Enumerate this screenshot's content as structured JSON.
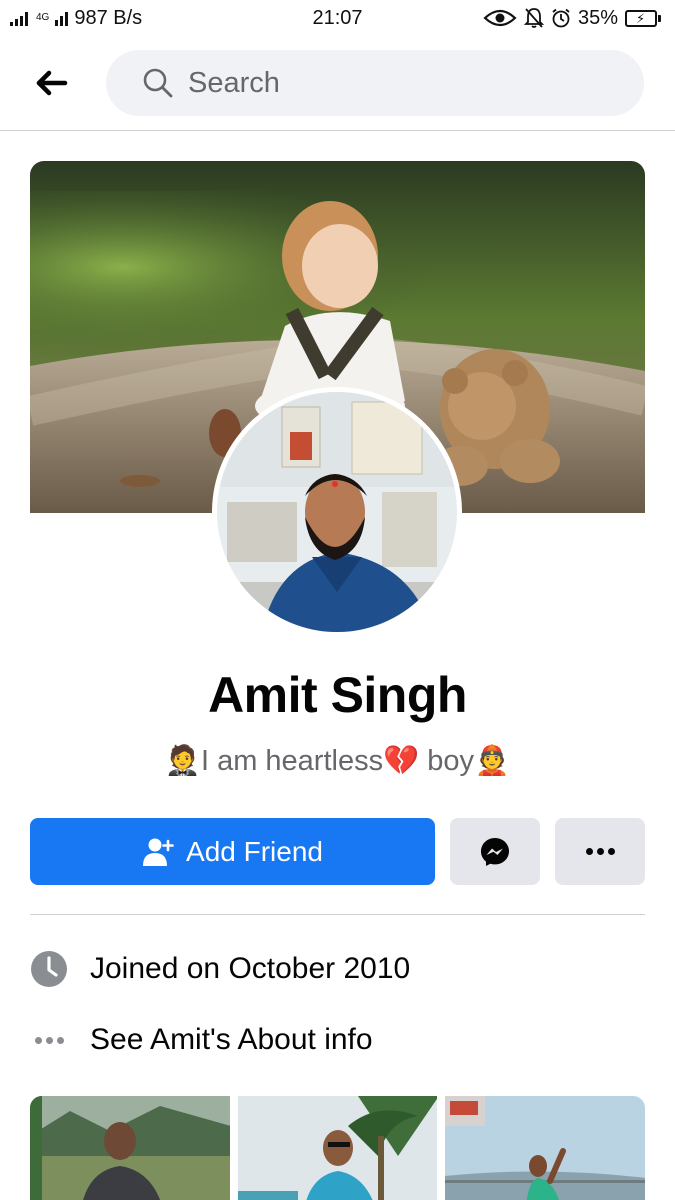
{
  "status_bar": {
    "network_speed": "987 B/s",
    "network_type": "4G",
    "time": "21:07",
    "battery": "35%",
    "battery_level": 0.35
  },
  "header": {
    "back_icon": "arrow-left-icon",
    "search_placeholder": "Search",
    "search_icon": "search-icon"
  },
  "profile": {
    "name": "Amit Singh",
    "bio": "🤵I am heartless💔 boy👲"
  },
  "actions": {
    "add_friend_label": "Add Friend",
    "add_friend_icon": "add-person-icon",
    "message_icon": "messenger-icon",
    "more_icon": "more-icon"
  },
  "info": {
    "joined": "Joined on October 2010",
    "about": "See Amit's About info"
  },
  "colors": {
    "primary": "#1877f2",
    "secondary_button": "#e4e6eb",
    "search_bg": "#f0f2f5",
    "muted_text": "#65676b"
  }
}
